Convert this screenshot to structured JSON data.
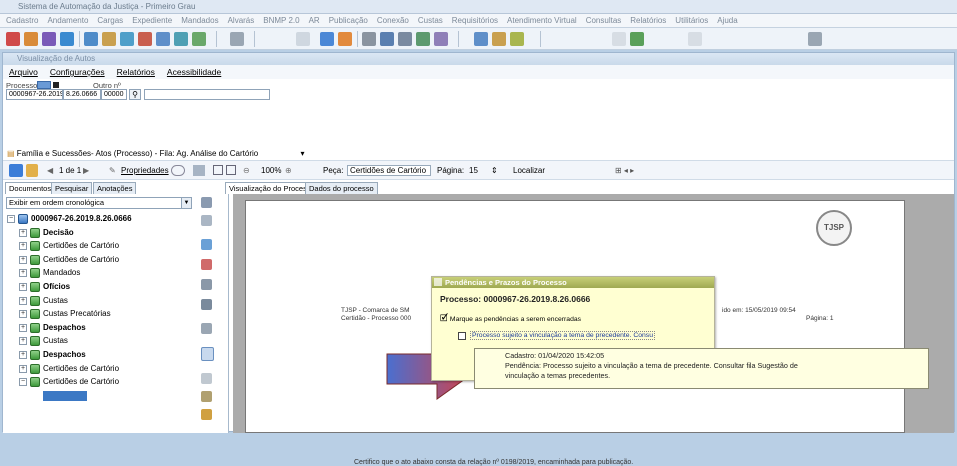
{
  "app": {
    "title": "Sistema de Automação da Justiça - Primeiro Grau",
    "menu": [
      "Cadastro",
      "Andamento",
      "Cargas",
      "Expediente",
      "Mandados",
      "Alvarás",
      "BNMP 2.0",
      "AR",
      "Publicação",
      "Conexão",
      "Custas",
      "Requisitórios",
      "Atendimento Virtual",
      "Consultas",
      "Relatórios",
      "Utilitários",
      "Ajuda"
    ]
  },
  "window": {
    "title": "Visualização de Autos",
    "menu": [
      "Arquivo",
      "Configurações",
      "Relatórios",
      "Acessibilidade"
    ],
    "processo_label": "Processo",
    "outro_label": "Outro nº",
    "processo_value": "0000967-26.2019",
    "processo_parts": [
      "8.26.0666",
      "00000"
    ],
    "path_text": "Família e Sucessões- Atos (Processo) - Fila: Ag. Análise do Cartório"
  },
  "toolbar": {
    "pages": "1 de 1",
    "properties": "Propriedades",
    "zoom": "100%",
    "peca_label": "Peça:",
    "peca_value": "Certidões de Cartório",
    "pagina_label": "Página:",
    "pagina_value": "15",
    "localizar": "Localizar"
  },
  "left_tabs": [
    "Documentos",
    "Pesquisar",
    "Anotações"
  ],
  "view_tabs": [
    "Visualização do Processo",
    "Dados do processo"
  ],
  "order_combo": "Exibir em ordem cronológica",
  "tree": {
    "root": "0000967-26.2019.8.26.0666",
    "items": [
      {
        "label": "Decisão",
        "bold": true
      },
      {
        "label": "Certidões de Cartório",
        "bold": false
      },
      {
        "label": "Certidões de Cartório",
        "bold": false
      },
      {
        "label": "Mandados",
        "bold": false
      },
      {
        "label": "Ofícios",
        "bold": true
      },
      {
        "label": "Custas",
        "bold": false
      },
      {
        "label": "Custas Precatórias",
        "bold": false
      },
      {
        "label": "Despachos",
        "bold": true
      },
      {
        "label": "Custas",
        "bold": false
      },
      {
        "label": "Despachos",
        "bold": true
      },
      {
        "label": "Certidões de Cartório",
        "bold": false
      },
      {
        "label": "Certidões de Cartório",
        "bold": false
      }
    ]
  },
  "document": {
    "seal": "TJSP",
    "header_left_1": "TJSP - Comarca de SM",
    "header_left_2": "Certidão - Processo 000",
    "header_right_1": "ido em: 15/05/2019 09:54",
    "header_right_2": "Página: 1",
    "body_line": "Certifico que o ato abaixo consta da relação nº 0198/2019, encaminhada para publicação."
  },
  "popup": {
    "title": "Pendências e Prazos do Processo",
    "processo": "Processo: 0000967-26.2019.8.26.0666",
    "instruction": "Marque as pendências a serem encerradas",
    "checkbox_label": "Processo sujeito a vinculação a tema de precedente. Consu"
  },
  "tooltip": {
    "line1": "Cadastro: 01/04/2020 15:42:05",
    "line2": "Pendência: Processo sujeito a vinculação a tema de precedente. Consultar fila Sugestão de",
    "line3": "vinculação a temas precedentes."
  },
  "colors": {
    "arrow_start": "#4a6fd0",
    "arrow_end": "#e03d3d",
    "popup_bg": "#ffffd2"
  }
}
